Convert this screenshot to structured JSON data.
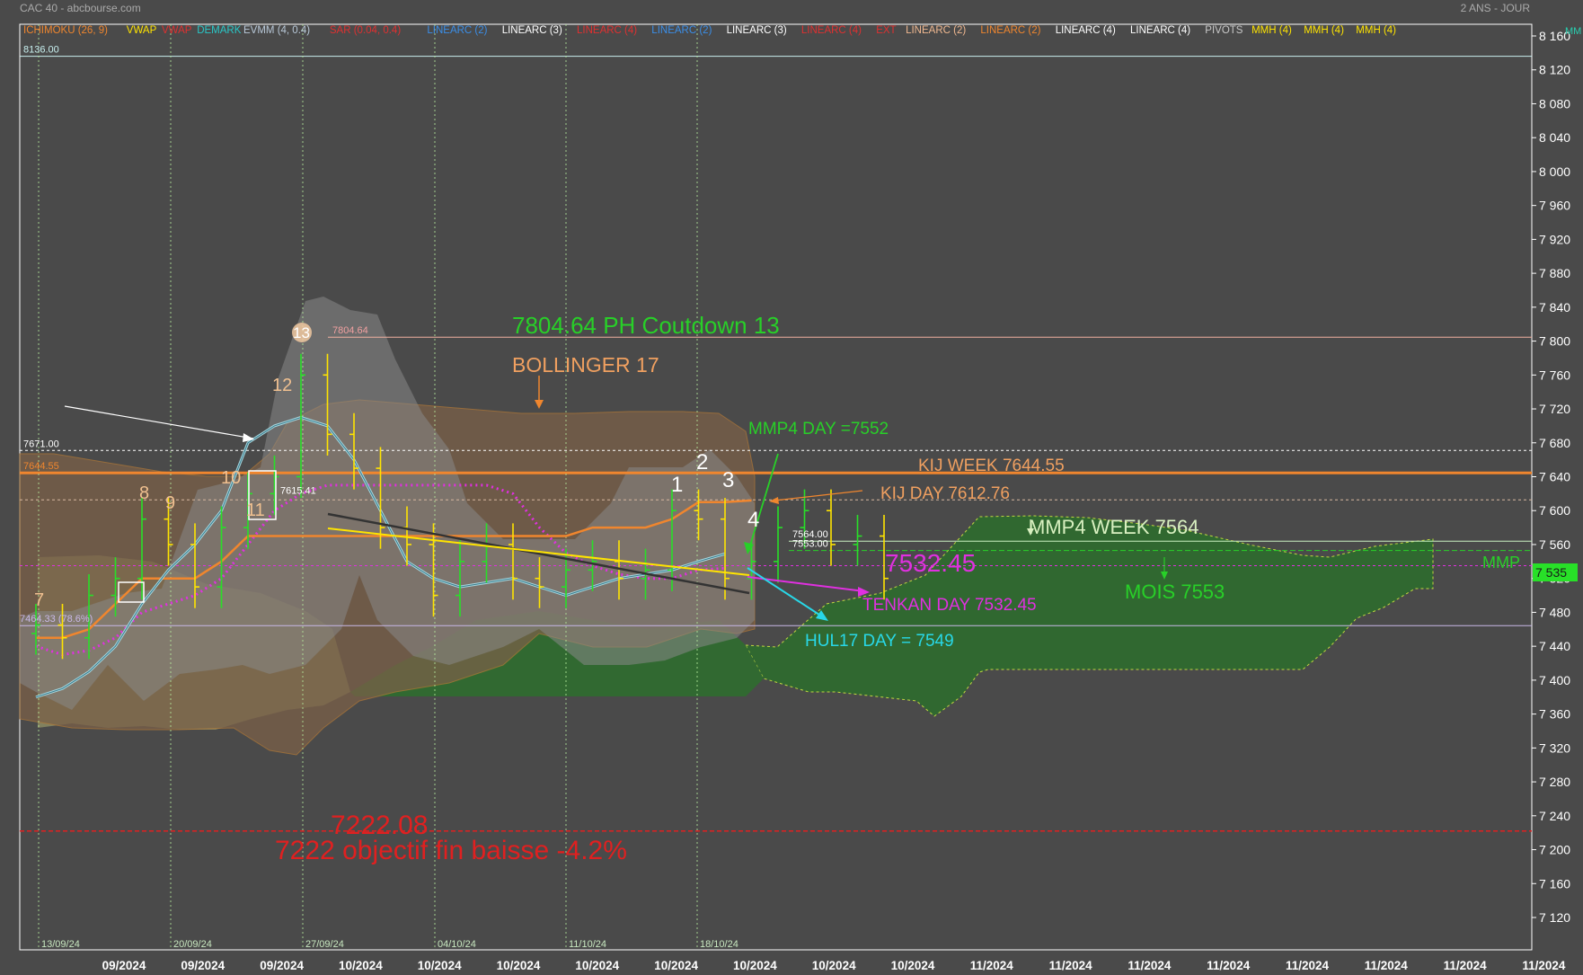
{
  "header": {
    "source": "CAC 40 - abcbourse.com",
    "period": "2 ANS - JOUR"
  },
  "legend": [
    {
      "text": "ICHIMOKU (26, 9)",
      "color": "#f0862e"
    },
    {
      "text": "VWAP",
      "color": "#ffe400"
    },
    {
      "text": "VWAP",
      "color": "#e03030"
    },
    {
      "text": "DEMARK",
      "color": "#28c8c8"
    },
    {
      "text": "EVMM (4, 0.4)",
      "color": "#b8c8d8"
    },
    {
      "text": "SAR (0.04, 0.4)",
      "color": "#e03030"
    },
    {
      "text": "LINEARC (2)",
      "color": "#3a8ee8"
    },
    {
      "text": "LINEARC (3)",
      "color": "#ffffff"
    },
    {
      "text": "LINEARC (4)",
      "color": "#e03030"
    },
    {
      "text": "LINEARC (2)",
      "color": "#3a8ee8"
    },
    {
      "text": "LINEARC (3)",
      "color": "#ffffff"
    },
    {
      "text": "LINEARC (4)",
      "color": "#e03030"
    },
    {
      "text": "EXT",
      "color": "#e03030"
    },
    {
      "text": "LINEARC (2)",
      "color": "#f0b890"
    },
    {
      "text": "LINEARC (2)",
      "color": "#f0862e"
    },
    {
      "text": "LINEARC (4)",
      "color": "#ffffff"
    },
    {
      "text": "LINEARC (4)",
      "color": "#ffffff"
    },
    {
      "text": "PIVOTS",
      "color": "#c8c8c8"
    },
    {
      "text": "MMH (4)",
      "color": "#ffe400"
    },
    {
      "text": "MMH (4)",
      "color": "#ffe400"
    },
    {
      "text": "MMH (4)",
      "color": "#ffe400"
    }
  ],
  "right_edge_label": "MM",
  "chart_data": {
    "type": "line",
    "title": "CAC 40",
    "ylim": [
      7090,
      8170
    ],
    "y_ticks": [
      8160,
      8120,
      8080,
      8040,
      8000,
      7960,
      7920,
      7880,
      7840,
      7800,
      7760,
      7720,
      7680,
      7640,
      7600,
      7560,
      7520,
      7480,
      7440,
      7400,
      7360,
      7320,
      7280,
      7240,
      7200,
      7160,
      7120
    ],
    "y_tick_labels": [
      "8 160",
      "8 120",
      "8 080",
      "8 040",
      "8 000",
      "7 960",
      "7 920",
      "7 880",
      "7 840",
      "7 800",
      "7 760",
      "7 720",
      "7 680",
      "7 640",
      "7 600",
      "7 560",
      "7 520",
      "7 480",
      "7 440",
      "7 400",
      "7 360",
      "7 320",
      "7 280",
      "7 240",
      "7 200",
      "7 160",
      "7 120"
    ],
    "x_ticks": [
      "09/2024",
      "09/2024",
      "09/2024",
      "10/2024",
      "10/2024",
      "10/2024",
      "10/2024",
      "10/2024",
      "10/2024",
      "10/2024",
      "10/2024",
      "11/2024",
      "11/2024",
      "11/2024",
      "11/2024",
      "11/2024",
      "11/2024",
      "11/2024",
      "11/2024"
    ],
    "week_dates": [
      "13/09/24",
      "20/09/24",
      "27/09/24",
      "04/10/24",
      "11/10/24",
      "18/10/24"
    ],
    "price_boxes": [
      {
        "text": "8136.00",
        "value": 8136,
        "color": "#c8f0f0"
      },
      {
        "text": "7671.00",
        "value": 7671,
        "color": "#ffffff"
      },
      {
        "text": "7644.55",
        "value": 7644.55,
        "color": "#f0862e"
      },
      {
        "text": "7464.33 (78.6%)",
        "value": 7464.33,
        "color": "#c8b8e8"
      },
      {
        "text": "7804.64",
        "value": 7804.64,
        "color": "#f0a0a0"
      },
      {
        "text": "7615.41",
        "value": 7615.41,
        "color": "#ffffff"
      },
      {
        "text": "7564.00",
        "value": 7564,
        "color": "#ffffff"
      },
      {
        "text": "7553.00",
        "value": 7553,
        "color": "#ffffff"
      }
    ],
    "current_price_label": "7 535",
    "current_price": 7535,
    "annotations": [
      {
        "text": "7804.64 PH Coutdown 13",
        "color": "#28d028",
        "size": 24
      },
      {
        "text": "BOLLINGER 17",
        "color": "#f0a060",
        "size": 22
      },
      {
        "text": "MMP4 DAY =7552",
        "color": "#28d028",
        "size": 18
      },
      {
        "text": "KIJ WEEK 7644.55",
        "color": "#f0a060",
        "size": 18
      },
      {
        "text": "KIJ DAY 7612.76",
        "color": "#f0a060",
        "size": 18
      },
      {
        "text": "MMP4 WEEK 7564",
        "color": "#d8f0c0",
        "size": 20
      },
      {
        "text": "7532.45",
        "color": "#e030e0",
        "size": 26
      },
      {
        "text": "MOIS 7553",
        "color": "#28d028",
        "size": 20
      },
      {
        "text": "TENKAN DAY 7532.45",
        "color": "#e030e0",
        "size": 18
      },
      {
        "text": "HUL17 DAY = 7549",
        "color": "#28d8e8",
        "size": 18
      },
      {
        "text": "MMP",
        "color": "#28d028",
        "size": 18
      },
      {
        "text": "7222.08",
        "color": "#e02020",
        "size": 28
      },
      {
        "text": "7222 objectif fin baisse -4.2%",
        "color": "#e02020",
        "size": 28
      }
    ],
    "count_labels": [
      "7",
      "8",
      "9",
      "10",
      "11",
      "12",
      "13",
      "1",
      "2",
      "3",
      "4"
    ],
    "levels": [
      {
        "value": 8136,
        "color": "#c8f0f0"
      },
      {
        "value": 7804.64,
        "color": "#f0b0a0"
      },
      {
        "value": 7671,
        "color": "#ffffff"
      },
      {
        "value": 7644.55,
        "color": "#f0862e"
      },
      {
        "value": 7612.76,
        "color": "#d8b8a0"
      },
      {
        "value": 7564,
        "color": "#c8f0c0"
      },
      {
        "value": 7553,
        "color": "#28d028"
      },
      {
        "value": 7535,
        "color": "#e030e0"
      },
      {
        "value": 7464.33,
        "color": "#c8b8e8"
      },
      {
        "value": 7222.08,
        "color": "#e02020"
      }
    ],
    "series": [
      {
        "name": "close",
        "color": "#ffe400",
        "values": [
          7465,
          7450,
          7500,
          7520,
          7590,
          7560,
          7510,
          7580,
          7620,
          7640,
          7760,
          7690,
          7650,
          7580,
          7560,
          7500,
          7540,
          7560,
          7520,
          7510,
          7530,
          7540,
          7520,
          7530,
          7600,
          7590,
          7520,
          7540,
          7580,
          7600,
          7560,
          7570,
          7520
        ]
      },
      {
        "name": "tenkan",
        "color": "#e030e0",
        "values": [
          7440,
          7430,
          7435,
          7450,
          7480,
          7490,
          7500,
          7520,
          7560,
          7600,
          7620,
          7630,
          7630,
          7630,
          7630,
          7630,
          7630,
          7630,
          7620,
          7580,
          7550,
          7535,
          7525,
          7520,
          7520,
          7530,
          7532
        ]
      },
      {
        "name": "kijun",
        "color": "#f0862e",
        "values": [
          7450,
          7450,
          7460,
          7490,
          7520,
          7520,
          7520,
          7540,
          7570,
          7570,
          7570,
          7570,
          7570,
          7570,
          7570,
          7570,
          7570,
          7570,
          7570,
          7570,
          7570,
          7580,
          7580,
          7580,
          7590,
          7610,
          7610,
          7612
        ]
      },
      {
        "name": "evmm",
        "color": "#a8d8e0",
        "values": [
          7380,
          7390,
          7410,
          7440,
          7490,
          7530,
          7560,
          7600,
          7680,
          7700,
          7710,
          7700,
          7660,
          7600,
          7540,
          7520,
          7510,
          7515,
          7520,
          7510,
          7500,
          7510,
          7520,
          7525,
          7530,
          7540,
          7549
        ]
      }
    ]
  }
}
